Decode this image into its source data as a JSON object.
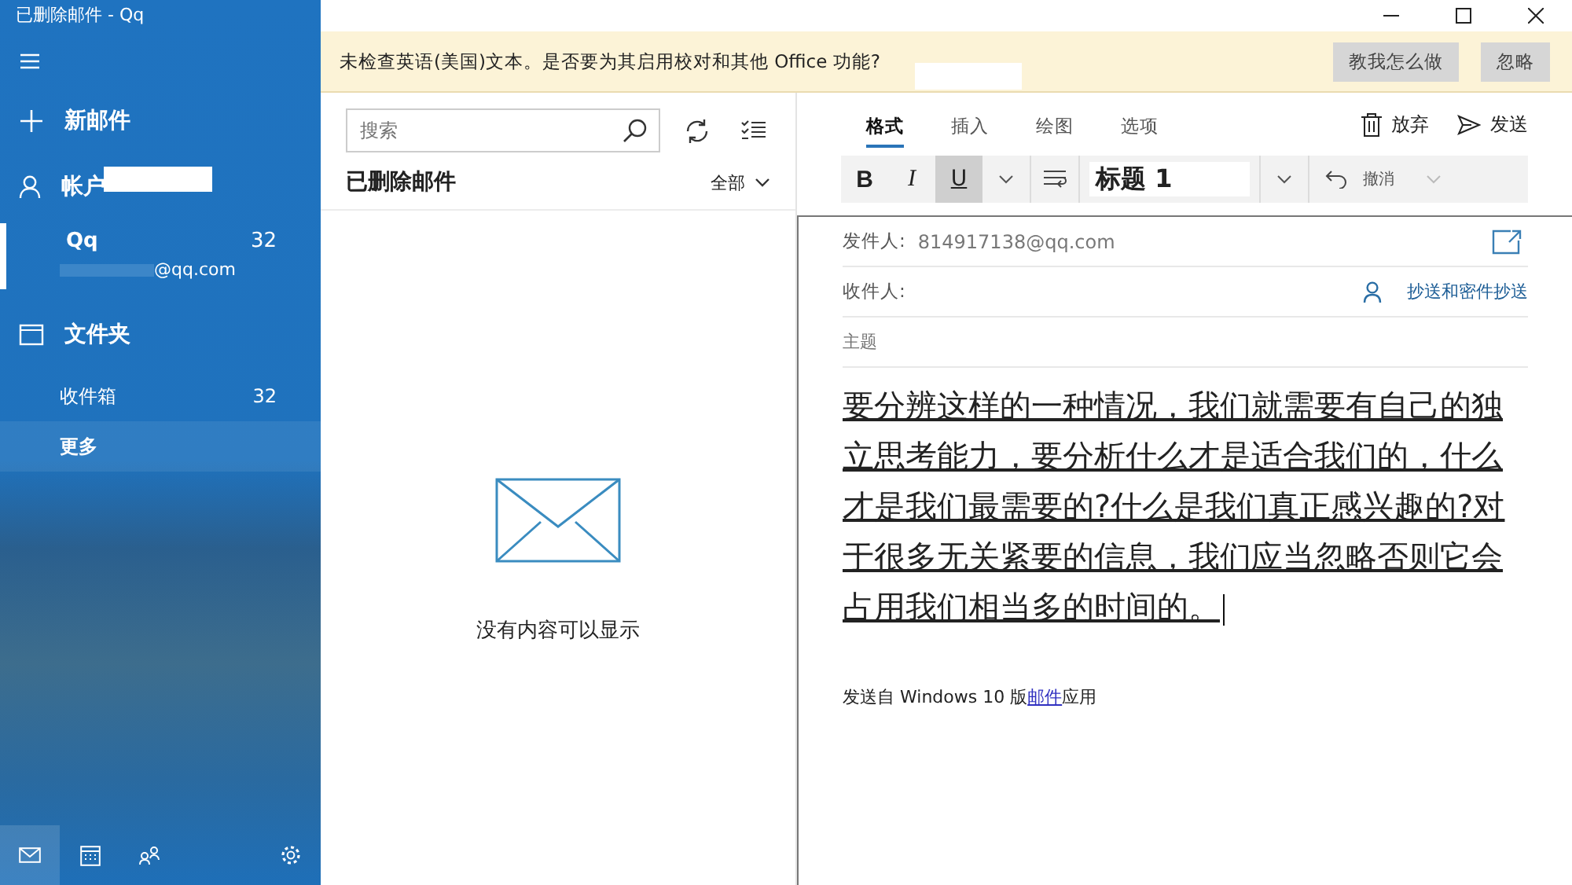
{
  "window": {
    "title": "已删除邮件 - Qq"
  },
  "sidebar": {
    "new_mail": "新邮件",
    "accounts_heading": "帐户",
    "accounts": [
      {
        "name": "Qq",
        "email": "@qq.com",
        "count": "32",
        "selected": true
      }
    ],
    "folders_heading": "文件夹",
    "folders": [
      {
        "label": "收件箱",
        "count": "32",
        "selected": false
      },
      {
        "label": "更多",
        "selected": true
      }
    ],
    "bottom_nav": [
      {
        "kind": "mail",
        "selected": true
      },
      {
        "kind": "calendar",
        "selected": false
      },
      {
        "kind": "people",
        "selected": false
      },
      {
        "kind": "settings",
        "selected": false
      }
    ]
  },
  "notification": {
    "message": "未检查英语(美国)文本。是否要为其启用校对和其他 Office 功能?",
    "buttons": [
      "教我怎么做",
      "忽略"
    ]
  },
  "message_list": {
    "search": {
      "placeholder": "搜索"
    },
    "title": "已删除邮件",
    "filter": "全部",
    "empty_text": "没有内容可以显示"
  },
  "compose": {
    "tabs": [
      {
        "label": "格式",
        "selected": true
      },
      {
        "label": "插入",
        "selected": false
      },
      {
        "label": "绘图",
        "selected": false
      },
      {
        "label": "选项",
        "selected": false
      }
    ],
    "actions": [
      {
        "kind": "discard",
        "label": "放弃"
      },
      {
        "kind": "send",
        "label": "发送"
      }
    ],
    "format": {
      "bold_label": "B",
      "italic_label": "I",
      "underline_label": "U",
      "bold": false,
      "italic": false,
      "underline": true,
      "style": "标题 1",
      "undo": "撤消"
    },
    "from_label": "发件人:",
    "from_value": "814917138@qq.com",
    "to_label": "收件人:",
    "cc_link": "抄送和密件抄送",
    "subject": {
      "placeholder": "主题"
    },
    "body": "要分辨这样的一种情况，我们就需要有自己的独立思考能力，要分析什么才是适合我们的，什么才是我们最需要的?什么是我们真正感兴趣的?对于很多无关紧要的信息，我们应当忽略否则它会占用我们相当多的时间的。",
    "signature": {
      "before": "发送自 Windows 10 版",
      "link": "邮件",
      "after": "应用"
    }
  }
}
